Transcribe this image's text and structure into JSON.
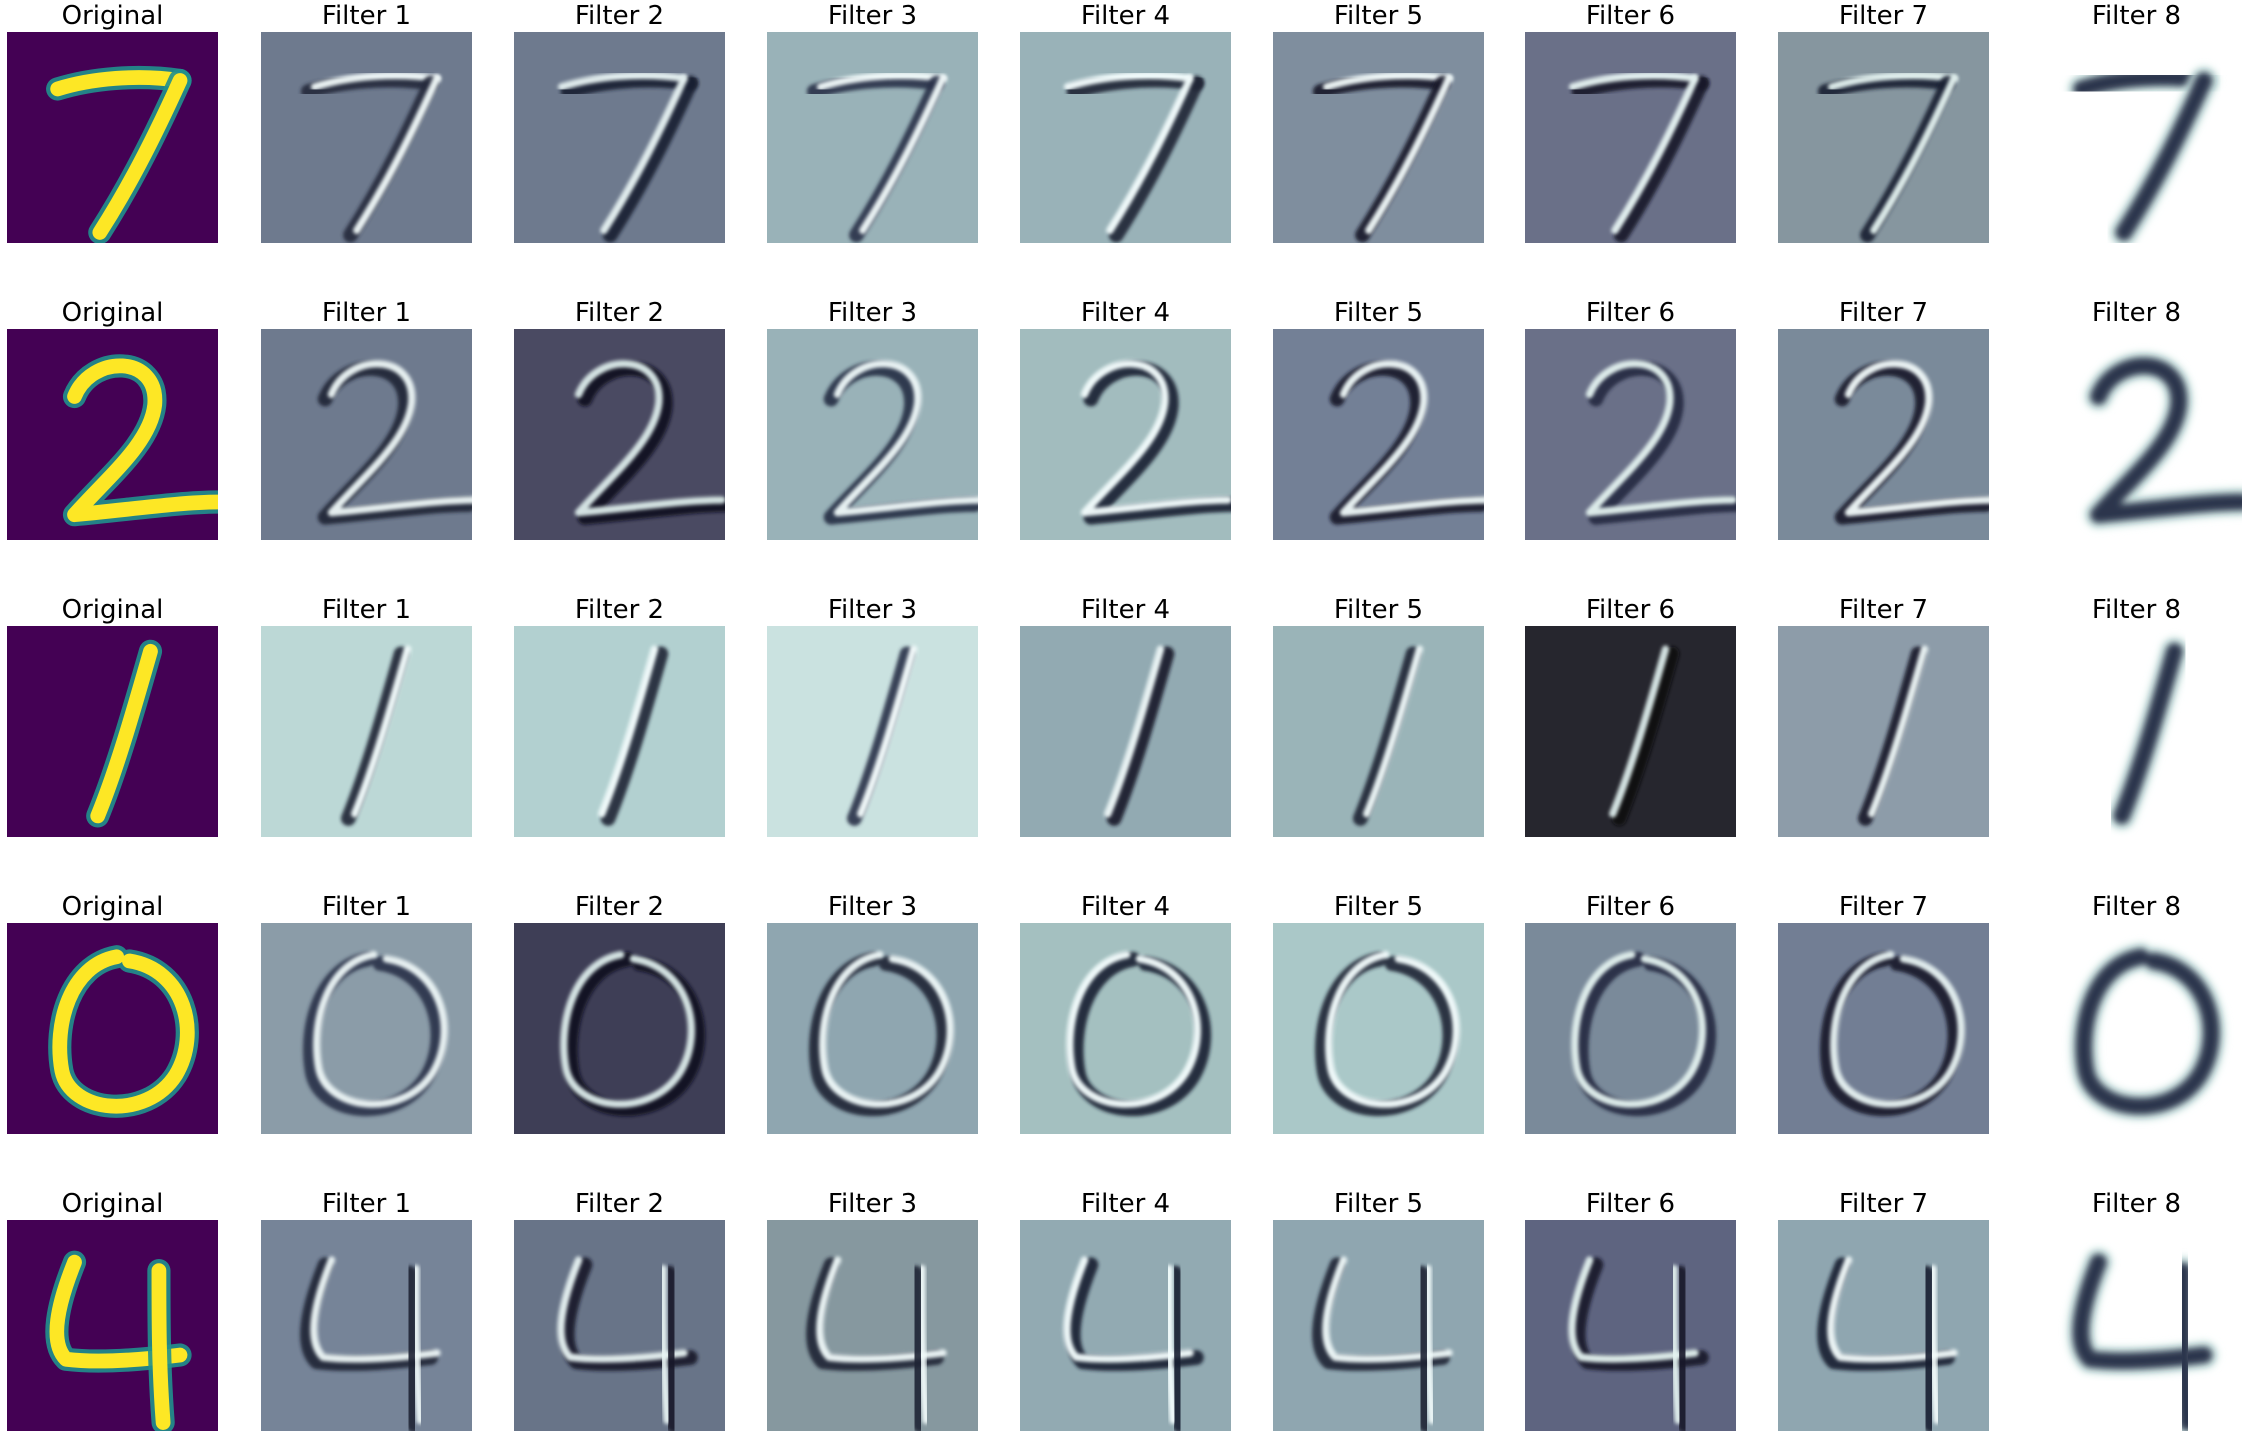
{
  "figure": {
    "rows": [
      {
        "digit": "7",
        "panels": [
          {
            "label": "Original",
            "kind": "original",
            "bg": "#440154",
            "fg": "#fde725",
            "hl": "#21908d"
          },
          {
            "label": "Filter 1",
            "kind": "filter",
            "bg": "#6e7a8e",
            "fg": "#22283a",
            "hl": "#f2fbfb"
          },
          {
            "label": "Filter 2",
            "kind": "filter",
            "bg": "#6e7a8e",
            "fg": "#1b2030",
            "hl": "#e8f3f3"
          },
          {
            "label": "Filter 3",
            "kind": "filter",
            "bg": "#99b2b8",
            "fg": "#2a3048",
            "hl": "#f2fbfb"
          },
          {
            "label": "Filter 4",
            "kind": "filter",
            "bg": "#99b2b8",
            "fg": "#1e2234",
            "hl": "#f5ffff"
          },
          {
            "label": "Filter 5",
            "kind": "filter",
            "bg": "#7f8e9e",
            "fg": "#161a28",
            "hl": "#f2fbfb"
          },
          {
            "label": "Filter 6",
            "kind": "filter",
            "bg": "#6a7088",
            "fg": "#14182a",
            "hl": "#e8f6f4"
          },
          {
            "label": "Filter 7",
            "kind": "filter",
            "bg": "#86969f",
            "fg": "#1b2030",
            "hl": "#e4f2f0"
          },
          {
            "label": "Filter 8",
            "kind": "last",
            "bg": "#ffffff",
            "fg": "#252b45",
            "hl": "#cfe8e4"
          }
        ]
      },
      {
        "digit": "2",
        "panels": [
          {
            "label": "Original",
            "kind": "original",
            "bg": "#440154",
            "fg": "#fde725",
            "hl": "#21908d"
          },
          {
            "label": "Filter 1",
            "kind": "filter",
            "bg": "#6e7a8e",
            "fg": "#1e2234",
            "hl": "#eef8f8"
          },
          {
            "label": "Filter 2",
            "kind": "filter",
            "bg": "#4a4a62",
            "fg": "#0e1020",
            "hl": "#dceceb"
          },
          {
            "label": "Filter 3",
            "kind": "filter",
            "bg": "#99b2b8",
            "fg": "#262c44",
            "hl": "#f0fafa"
          },
          {
            "label": "Filter 4",
            "kind": "filter",
            "bg": "#a2bcbe",
            "fg": "#1a1e30",
            "hl": "#f5ffff"
          },
          {
            "label": "Filter 5",
            "kind": "filter",
            "bg": "#738096",
            "fg": "#14182a",
            "hl": "#f0fafa"
          },
          {
            "label": "Filter 6",
            "kind": "filter",
            "bg": "#6a7088",
            "fg": "#232a40",
            "hl": "#e4f2f0"
          },
          {
            "label": "Filter 7",
            "kind": "filter",
            "bg": "#7a8a9a",
            "fg": "#14182a",
            "hl": "#f2fbfb"
          },
          {
            "label": "Filter 8",
            "kind": "last",
            "bg": "#ffffff",
            "fg": "#252b45",
            "hl": "#cfe8e4"
          }
        ]
      },
      {
        "digit": "1",
        "panels": [
          {
            "label": "Original",
            "kind": "original",
            "bg": "#440154",
            "fg": "#fde725",
            "hl": "#21908d"
          },
          {
            "label": "Filter 1",
            "kind": "filter",
            "bg": "#bcd8d6",
            "fg": "#1e2234",
            "hl": "#f5ffff"
          },
          {
            "label": "Filter 2",
            "kind": "filter",
            "bg": "#b2d0d0",
            "fg": "#1e2234",
            "hl": "#f5ffff"
          },
          {
            "label": "Filter 3",
            "kind": "filter",
            "bg": "#cae2e0",
            "fg": "#2a3048",
            "hl": "#f8ffff"
          },
          {
            "label": "Filter 4",
            "kind": "filter",
            "bg": "#92aab2",
            "fg": "#161a28",
            "hl": "#f0fafa"
          },
          {
            "label": "Filter 5",
            "kind": "filter",
            "bg": "#9ab4b8",
            "fg": "#1e2234",
            "hl": "#f0fafa"
          },
          {
            "label": "Filter 6",
            "kind": "filter",
            "bg": "#26262e",
            "fg": "#0a0a12",
            "hl": "#dceceb"
          },
          {
            "label": "Filter 7",
            "kind": "filter",
            "bg": "#8d9ca9",
            "fg": "#161a28",
            "hl": "#eef8f8"
          },
          {
            "label": "Filter 8",
            "kind": "last",
            "bg": "#ffffff",
            "fg": "#252b45",
            "hl": "#cfe8e4"
          }
        ]
      },
      {
        "digit": "0",
        "panels": [
          {
            "label": "Original",
            "kind": "original",
            "bg": "#440154",
            "fg": "#fde725",
            "hl": "#21908d"
          },
          {
            "label": "Filter 1",
            "kind": "filter",
            "bg": "#8b9ca8",
            "fg": "#2a3048",
            "hl": "#eef8f8"
          },
          {
            "label": "Filter 2",
            "kind": "filter",
            "bg": "#3e3e56",
            "fg": "#0e1020",
            "hl": "#dceceb"
          },
          {
            "label": "Filter 3",
            "kind": "filter",
            "bg": "#8fa6b0",
            "fg": "#1e2234",
            "hl": "#f0fafa"
          },
          {
            "label": "Filter 4",
            "kind": "filter",
            "bg": "#a4c0c0",
            "fg": "#1a1e30",
            "hl": "#f5ffff"
          },
          {
            "label": "Filter 5",
            "kind": "filter",
            "bg": "#aac8c8",
            "fg": "#1e2234",
            "hl": "#f5ffff"
          },
          {
            "label": "Filter 6",
            "kind": "filter",
            "bg": "#7a8a9a",
            "fg": "#232a40",
            "hl": "#e4f2f0"
          },
          {
            "label": "Filter 7",
            "kind": "filter",
            "bg": "#727e94",
            "fg": "#14182a",
            "hl": "#e8f3f3"
          },
          {
            "label": "Filter 8",
            "kind": "last",
            "bg": "#ffffff",
            "fg": "#252b45",
            "hl": "#cfe8e4"
          }
        ]
      },
      {
        "digit": "4",
        "panels": [
          {
            "label": "Original",
            "kind": "original",
            "bg": "#440154",
            "fg": "#fde725",
            "hl": "#21908d"
          },
          {
            "label": "Filter 1",
            "kind": "filter",
            "bg": "#768498",
            "fg": "#1e2234",
            "hl": "#eef8f8"
          },
          {
            "label": "Filter 2",
            "kind": "filter",
            "bg": "#687488",
            "fg": "#14182a",
            "hl": "#e8f3f3"
          },
          {
            "label": "Filter 3",
            "kind": "filter",
            "bg": "#86989f",
            "fg": "#1e2234",
            "hl": "#f0fafa"
          },
          {
            "label": "Filter 4",
            "kind": "filter",
            "bg": "#92aab2",
            "fg": "#1a1e30",
            "hl": "#f5ffff"
          },
          {
            "label": "Filter 5",
            "kind": "filter",
            "bg": "#8fa6b0",
            "fg": "#1e2234",
            "hl": "#f0fafa"
          },
          {
            "label": "Filter 6",
            "kind": "filter",
            "bg": "#5e6480",
            "fg": "#14182a",
            "hl": "#e4f2f0"
          },
          {
            "label": "Filter 7",
            "kind": "filter",
            "bg": "#8fa6b0",
            "fg": "#1b2030",
            "hl": "#f2fbfb"
          },
          {
            "label": "Filter 8",
            "kind": "last",
            "bg": "#ffffff",
            "fg": "#252b45",
            "hl": "#cfe8e4"
          }
        ]
      }
    ]
  }
}
